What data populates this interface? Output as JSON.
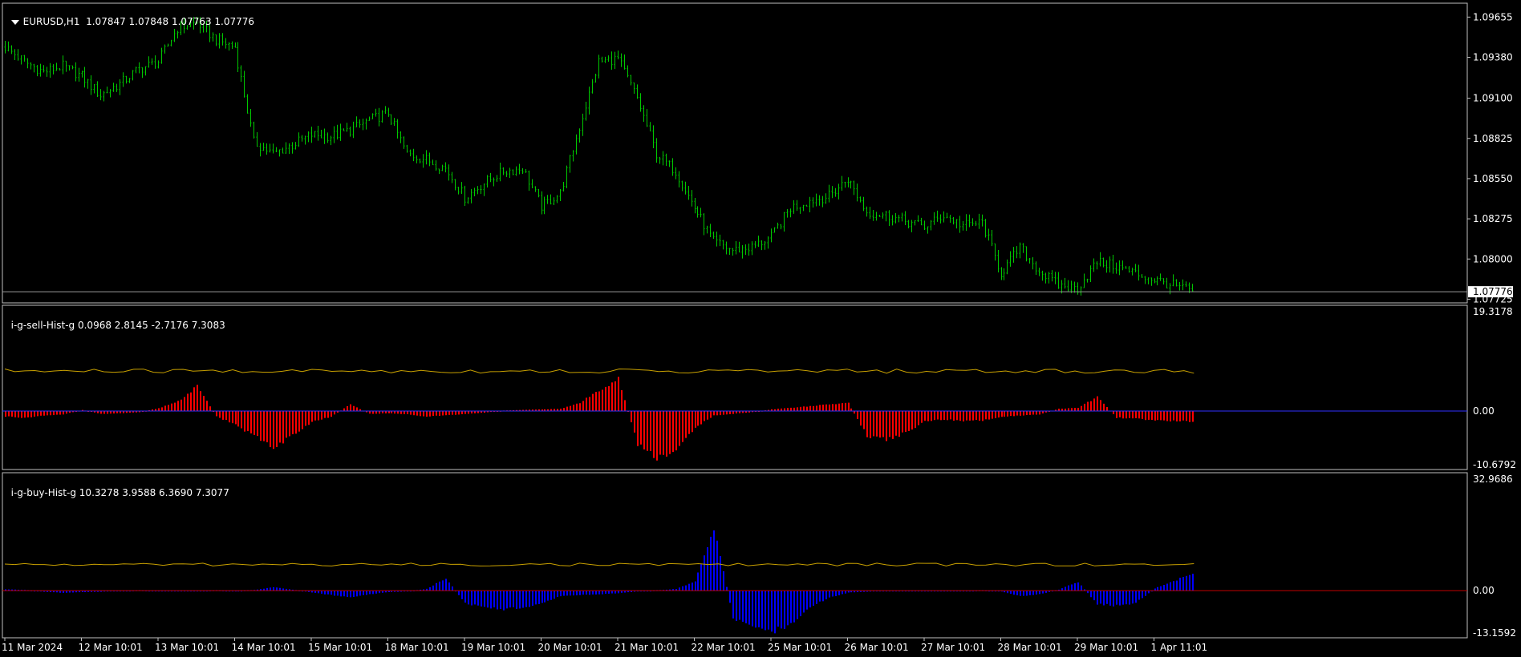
{
  "chart_data": [
    {
      "type": "line",
      "style": "ohlc-bars",
      "symbol_label": "EURUSD,H1",
      "ohlc_label": "1.07847 1.07848 1.07763 1.07776",
      "ylim": [
        1.077,
        1.0975
      ],
      "y_ticks": [
        "1.09655",
        "1.09380",
        "1.09100",
        "1.08825",
        "1.08550",
        "1.08275",
        "1.08000",
        "1.07725"
      ],
      "last_price": "1.07776",
      "colors": {
        "bars": "#00c800",
        "price_line": "#9a9a9a"
      },
      "close_series_by_day": [
        {
          "day": "11 Mar 2024",
          "close": [
            1.0945,
            1.0935,
            1.0928,
            1.0932
          ]
        },
        {
          "day": "12 Mar 10:01",
          "close": [
            1.0925,
            1.0912,
            1.092,
            1.093
          ]
        },
        {
          "day": "13 Mar 10:01",
          "close": [
            1.0935,
            1.0958,
            1.0962,
            1.095
          ]
        },
        {
          "day": "14 Mar 10:01",
          "close": [
            1.0945,
            1.088,
            1.0872,
            1.0878
          ]
        },
        {
          "day": "15 Mar 10:01",
          "close": [
            1.0885,
            1.0884,
            1.0888,
            1.0895
          ]
        },
        {
          "day": "18 Mar 10:01",
          "close": [
            1.09,
            1.0872,
            1.0868,
            1.0862
          ]
        },
        {
          "day": "19 Mar 10:01",
          "close": [
            1.0842,
            1.0852,
            1.086,
            1.0862
          ]
        },
        {
          "day": "20 Mar 10:01",
          "close": [
            1.0836,
            1.0845,
            1.089,
            1.0935
          ]
        },
        {
          "day": "21 Mar 10:01",
          "close": [
            1.0937,
            1.091,
            1.0872,
            1.086
          ]
        },
        {
          "day": "22 Mar 10:01",
          "close": [
            1.0835,
            1.0812,
            1.0806,
            1.0808
          ]
        },
        {
          "day": "25 Mar 10:01",
          "close": [
            1.0815,
            1.0835,
            1.084,
            1.0843
          ]
        },
        {
          "day": "26 Mar 10:01",
          "close": [
            1.0855,
            1.0832,
            1.083,
            1.0826
          ]
        },
        {
          "day": "27 Mar 10:01",
          "close": [
            1.0822,
            1.083,
            1.0823,
            1.0825
          ]
        },
        {
          "day": "28 Mar 10:01",
          "close": [
            1.079,
            1.0808,
            1.0792,
            1.0782
          ]
        },
        {
          "day": "29 Mar 10:01",
          "close": [
            1.078,
            1.0798,
            1.0795,
            1.079
          ]
        },
        {
          "day": "1 Apr 11:01",
          "close": [
            1.0786,
            1.0778
          ]
        }
      ]
    },
    {
      "type": "bar",
      "name": "i-g-sell-Hist-g",
      "values_label": "0.0968 2.8145 -2.7176 7.3083",
      "ylim": [
        -10.6792,
        19.3178
      ],
      "y_ticks": [
        "19.3178",
        "0.00",
        "-10.6792"
      ],
      "colors": {
        "hist": "#ff0000",
        "signal": "#c8a000",
        "zero": "#3030ff"
      },
      "signal_level": 7.3,
      "hist_by_day": [
        [
          -1.0,
          -1.2,
          -0.8,
          -0.6
        ],
        [
          0.2,
          -0.5,
          -0.4,
          -0.2
        ],
        [
          0.5,
          1.8,
          4.5,
          -1.0
        ],
        [
          -2.5,
          -4.5,
          -6.5,
          -4.5
        ],
        [
          -2.0,
          -1.0,
          1.2,
          -0.5
        ],
        [
          -0.4,
          -0.6,
          -1.0,
          -0.8
        ],
        [
          -0.5,
          -0.3,
          0.1,
          0.2
        ],
        [
          0.3,
          0.4,
          1.5,
          3.8
        ],
        [
          6.0,
          -6.0,
          -8.6,
          -7.0
        ],
        [
          -3.0,
          -0.8,
          -0.5,
          -0.2
        ],
        [
          0.3,
          0.6,
          0.9,
          1.2
        ],
        [
          1.5,
          -4.5,
          -5.2,
          -4.0
        ],
        [
          -1.8,
          -1.5,
          -1.8,
          -1.7
        ],
        [
          -1.0,
          -0.8,
          -0.6,
          0.4
        ],
        [
          0.6,
          2.6,
          -1.2,
          -1.4
        ],
        [
          -1.7,
          -1.9
        ]
      ]
    },
    {
      "type": "bar",
      "name": "i-g-buy-Hist-g",
      "values_label": "10.3278 3.9588 6.3690 7.3077",
      "ylim": [
        -13.1592,
        32.9686
      ],
      "y_ticks": [
        "32.9686",
        "0.00",
        "-13.1592"
      ],
      "colors": {
        "hist": "#0000ff",
        "signal": "#c8a000",
        "zero": "#c00000"
      },
      "signal_level": 7.3,
      "hist_by_day": [
        [
          0.4,
          0.2,
          -0.3,
          -0.6
        ],
        [
          -0.4,
          -0.3,
          -0.1,
          0.1
        ],
        [
          -0.1,
          -0.2,
          -0.1,
          0.1
        ],
        [
          -0.1,
          0.2,
          1.0,
          0.3
        ],
        [
          -0.5,
          -1.2,
          -1.8,
          -1.0
        ],
        [
          -0.4,
          -0.2,
          0.5,
          3.5
        ],
        [
          -3.5,
          -4.8,
          -5.2,
          -4.6
        ],
        [
          -3.5,
          -1.5,
          -1.2,
          -1.0
        ],
        [
          -0.7,
          -0.2,
          0.1,
          0.5
        ],
        [
          2.5,
          18.0,
          -7.5,
          -10.0
        ],
        [
          -11.5,
          -9.5,
          -4.5,
          -2.0
        ],
        [
          -0.5,
          -0.3,
          -0.1,
          -0.2
        ],
        [
          -0.1,
          -0.2,
          -0.1,
          0.1
        ],
        [
          -0.2,
          -1.5,
          -1.0,
          0.3
        ],
        [
          2.5,
          -3.8,
          -4.2,
          -3.4
        ],
        [
          0.6,
          4.8
        ]
      ]
    }
  ],
  "x_axis_labels": [
    "11 Mar 2024",
    "12 Mar 10:01",
    "13 Mar 10:01",
    "14 Mar 10:01",
    "15 Mar 10:01",
    "18 Mar 10:01",
    "19 Mar 10:01",
    "20 Mar 10:01",
    "21 Mar 10:01",
    "22 Mar 10:01",
    "25 Mar 10:01",
    "26 Mar 10:01",
    "27 Mar 10:01",
    "28 Mar 10:01",
    "29 Mar 10:01",
    "1 Apr 11:01"
  ]
}
